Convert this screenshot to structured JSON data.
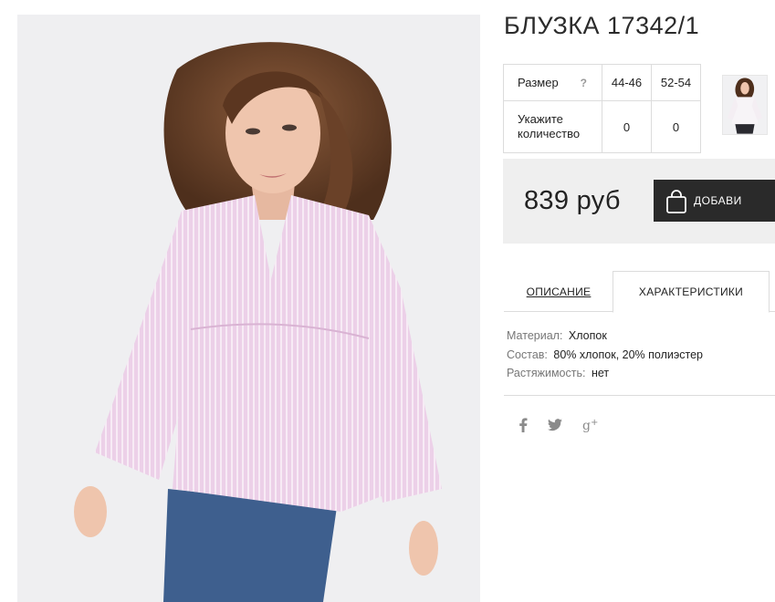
{
  "product": {
    "title": "БЛУЗКА 17342/1",
    "price": "839 руб",
    "add_button_label": "ДОБАВИ"
  },
  "sizes": {
    "size_label": "Размер",
    "help_mark": "?",
    "qty_label": "Укажите количество",
    "columns": [
      {
        "size": "44-46",
        "qty": "0"
      },
      {
        "size": "52-54",
        "qty": "0"
      }
    ]
  },
  "tabs": {
    "description": "ОПИСАНИЕ",
    "characteristics": "ХАРАКТЕРИСТИКИ",
    "active": "characteristics"
  },
  "characteristics": [
    {
      "key": "Материал:",
      "value": "Хлопок"
    },
    {
      "key": "Состав:",
      "value": "80% хлопок, 20% полиэстер"
    },
    {
      "key": "Растяжимость:",
      "value": "нет"
    }
  ],
  "social": [
    "facebook-icon",
    "twitter-icon",
    "google-plus-icon"
  ],
  "colors": {
    "button_bg": "#2a2a2a",
    "buy_box_bg": "#efefef",
    "blouse_pink": "#e9c9e4"
  }
}
